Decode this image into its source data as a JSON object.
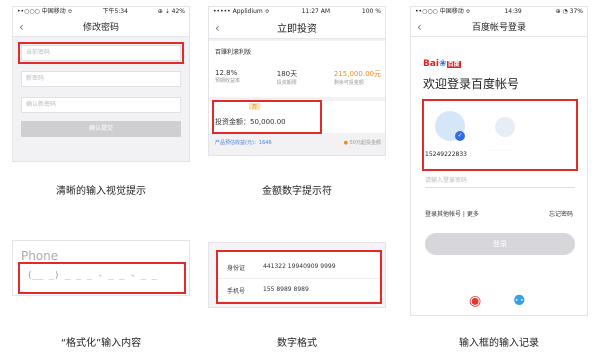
{
  "screens": {
    "pwd": {
      "carrier": "••○○○ 中国移动 ≎",
      "time": "下午5:34",
      "battery": "⊕ ⇣ 42%",
      "title": "修改密码",
      "fields": [
        "当前密码",
        "新密码",
        "确认新密码"
      ],
      "submit": "确认提交"
    },
    "invest": {
      "carrier": "••••• Applidium ≎",
      "time": "11:27 AM",
      "battery": "100 %",
      "title": "立即投资",
      "product": "百赚利滚利版",
      "stats": [
        {
          "value": "12.8%",
          "label": "预期收益率",
          "color": "#333333"
        },
        {
          "value": "180天",
          "label": "投资期限",
          "color": "#333333"
        },
        {
          "value": "215,000.00元",
          "label": "剩余可投金额",
          "color": "#f08c1e"
        }
      ],
      "badge": "万",
      "amount_label": "投资金额：",
      "amount_value": "50,000.00",
      "footer_left": "产品预估收益(元)：1646",
      "footer_right": "50元起投金额"
    },
    "phone": {
      "placeholder": "Phone",
      "mask": "(__ _) _ _ _ - _ _ - _ _"
    },
    "idcard": {
      "rows": [
        {
          "label": "身份证",
          "value": "441322 19940909 9999"
        },
        {
          "label": "手机号",
          "value": "155 8989 8989"
        }
      ]
    },
    "baidu": {
      "carrier": "••○○○ 中国移动 ≎",
      "time": "14:39",
      "battery": "⊕ ◔ 37%",
      "title": "百度帐号登录",
      "logo_text": "Bai",
      "logo_suffix": "百度",
      "welcome": "欢迎登录百度帐号",
      "account": "15249222833",
      "account2": "……………",
      "pwd_placeholder": "请输入登录密码",
      "other": "登录其他帐号",
      "more": "更多",
      "forget": "忘记密码",
      "login": "登录",
      "weibo": "◉",
      "qq": "⚉"
    }
  },
  "captions": {
    "c1": "清晰的输入视觉提示",
    "c2": "金额数字提示符",
    "c3": "“格式化”输入内容",
    "c4": "数字格式",
    "c5": "输入框的输入记录"
  },
  "colors": {
    "highlight": "#e32a2a",
    "accent": "#f08c1e",
    "baidu_blue": "#2f6de1"
  }
}
